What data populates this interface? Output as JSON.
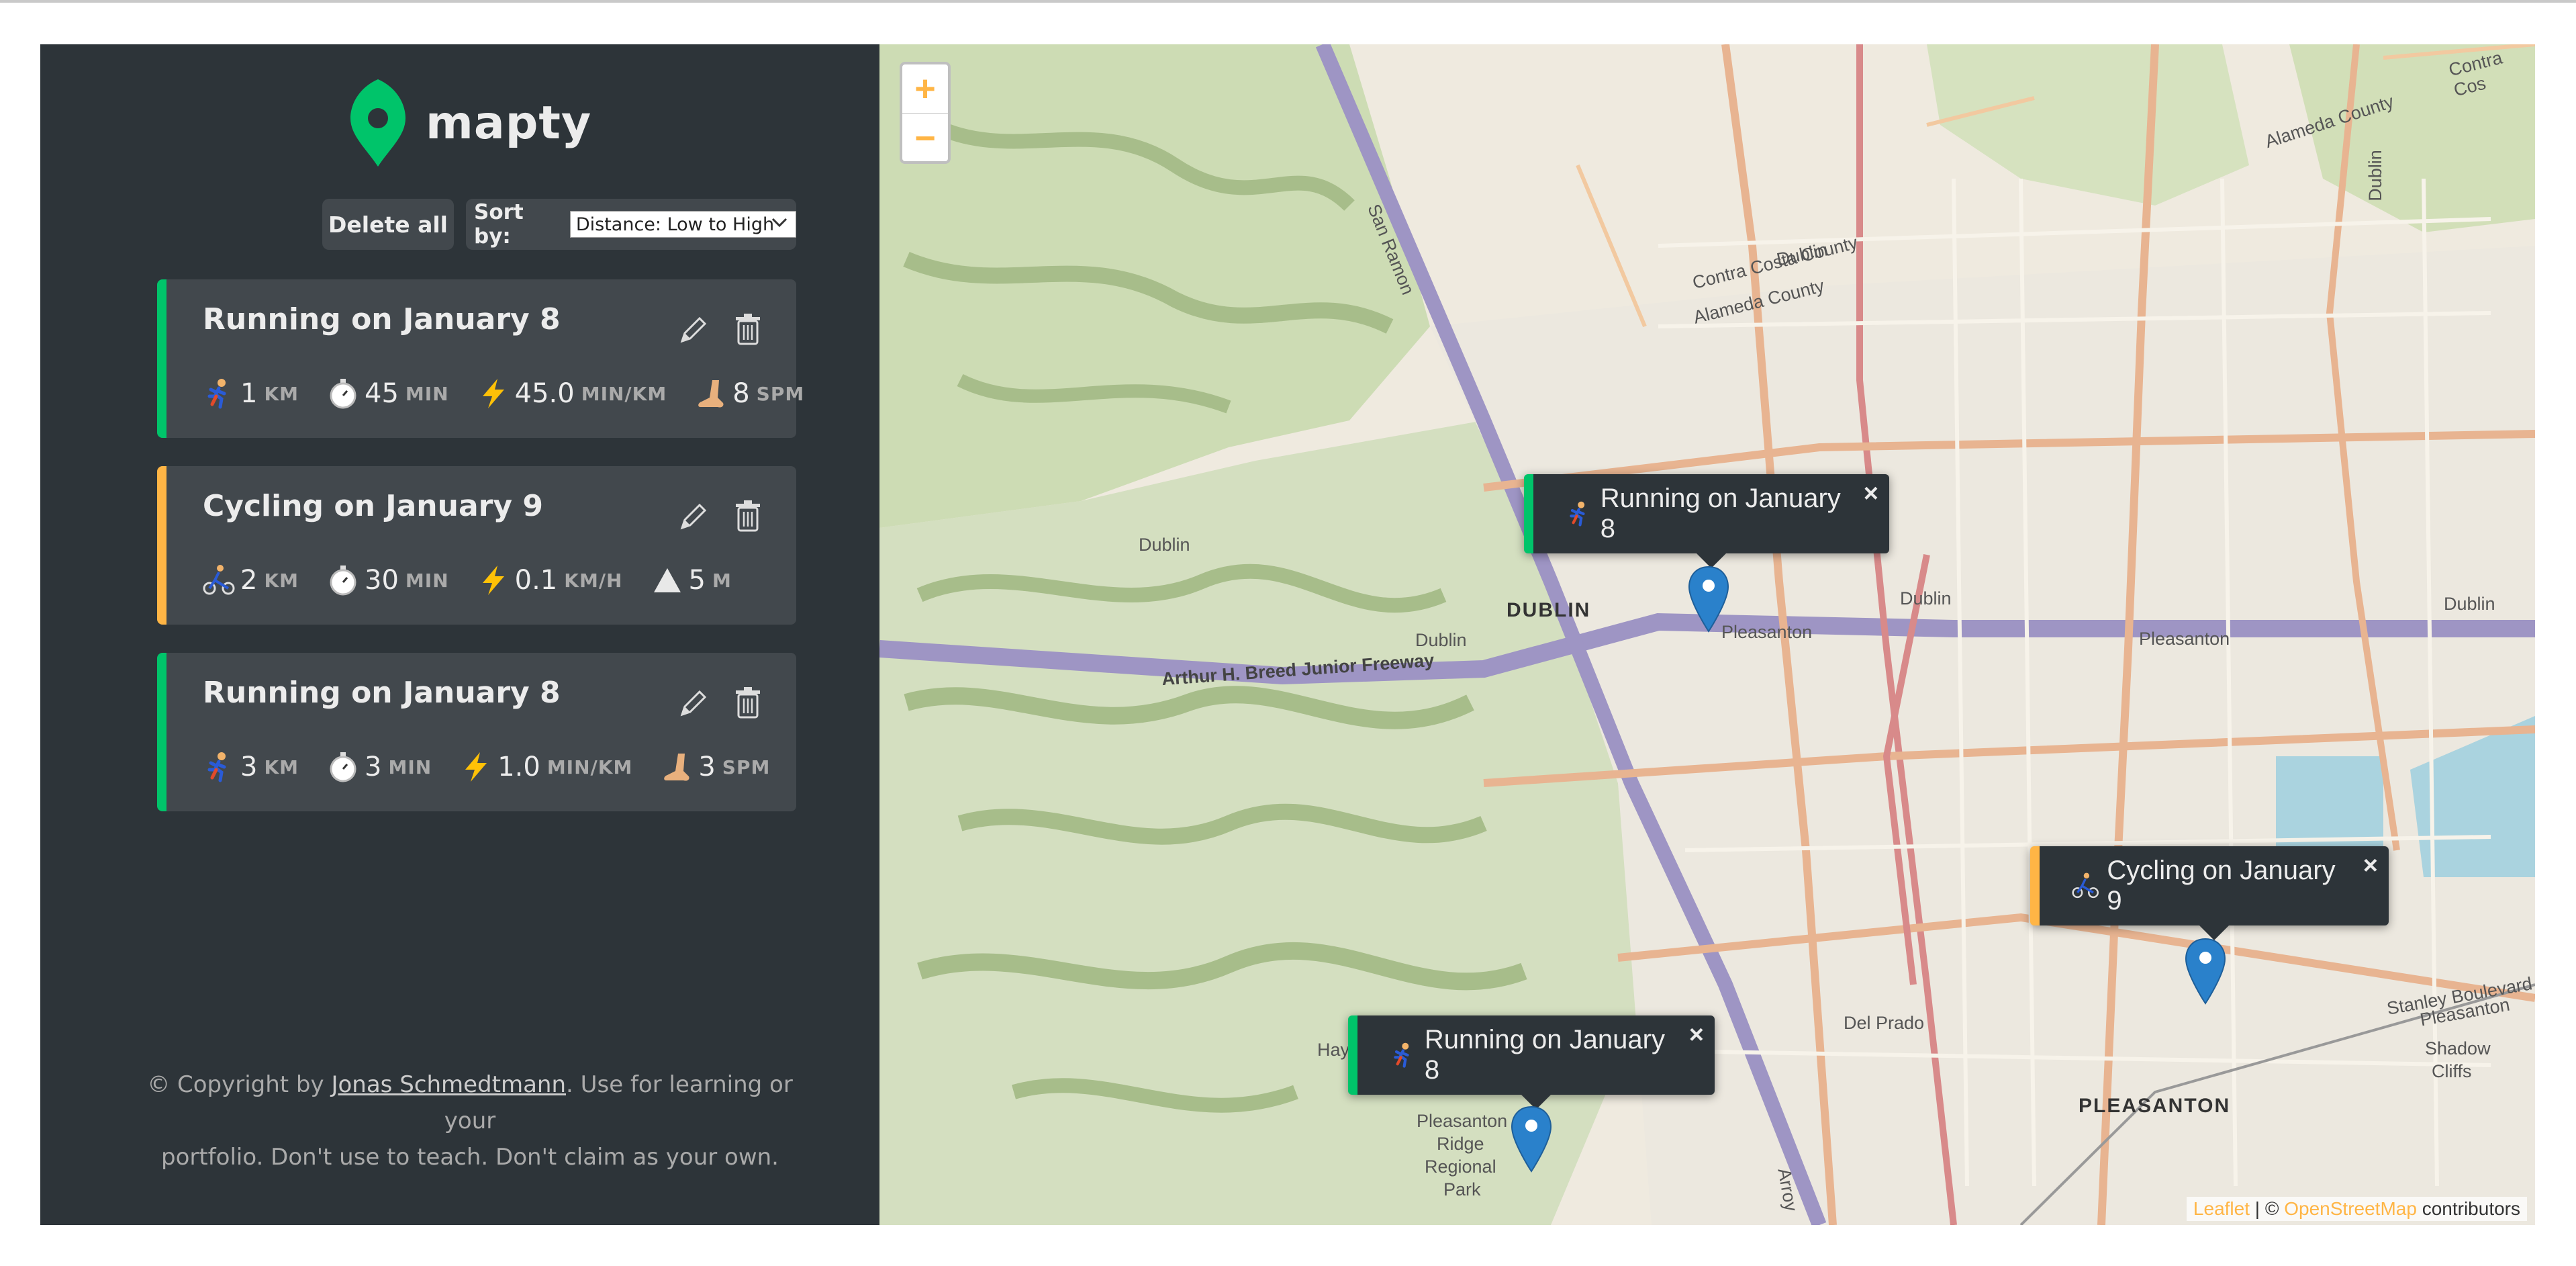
{
  "app": {
    "name": "mapty"
  },
  "controls": {
    "delete_all_label": "Delete all",
    "sort_label": "Sort by:",
    "sort_value": "Distance: Low to High"
  },
  "workouts": [
    {
      "type": "running",
      "title": "Running on January 8",
      "distance": "1",
      "distance_unit": "KM",
      "duration": "45",
      "duration_unit": "MIN",
      "pace": "45.0",
      "pace_unit": "MIN/KM",
      "cadence": "8",
      "cadence_unit": "SPM"
    },
    {
      "type": "cycling",
      "title": "Cycling on January 9",
      "distance": "2",
      "distance_unit": "KM",
      "duration": "30",
      "duration_unit": "MIN",
      "speed": "0.1",
      "speed_unit": "KM/H",
      "elevation": "5",
      "elevation_unit": "M"
    },
    {
      "type": "running",
      "title": "Running on January 8",
      "distance": "3",
      "distance_unit": "KM",
      "duration": "3",
      "duration_unit": "MIN",
      "pace": "1.0",
      "pace_unit": "MIN/KM",
      "cadence": "3",
      "cadence_unit": "SPM"
    }
  ],
  "footer": {
    "copyright_prefix": "© Copyright by ",
    "author": "Jonas Schmedtmann",
    "copyright_suffix": ". Use for learning or your",
    "copyright_line2": "portfolio. Don't use to teach. Don't claim as your own."
  },
  "map": {
    "zoom_in": "+",
    "zoom_out": "−",
    "attribution_leaflet": "Leaflet",
    "attribution_sep": " | © ",
    "attribution_osm": "OpenStreetMap",
    "attribution_suffix": " contributors",
    "popups": [
      {
        "type": "running",
        "label": "Running on January 8",
        "close": "×"
      },
      {
        "type": "cycling",
        "label": "Cycling on January 9",
        "close": "×"
      },
      {
        "type": "running",
        "label": "Running on January 8",
        "close": "×"
      }
    ],
    "labels": {
      "dublin_big": "DUBLIN",
      "pleasanton_big": "PLEASANTON",
      "freeway": "Arthur H. Breed Junior Freeway",
      "contra_costa": "Contra Costa County",
      "alameda": "Alameda County",
      "alameda_ne": "Alameda County",
      "contra_ne": "Contra Cos",
      "dublin_top": "Dublin",
      "dublin_left": "Dublin",
      "dublin_mid": "Dublin",
      "dublin_road": "Dublin",
      "dublin_right": "Dublin",
      "dublin_vert": "Dublin",
      "pleasanton_small": "Pleasanton",
      "pleasanton_road": "Pleasanton",
      "san_ramon": "San Ramon",
      "del_prado": "Del Prado",
      "hay": "Hay",
      "pleasanton_ridge_1": "Pleasanton",
      "pleasanton_ridge_2": "Ridge",
      "pleasanton_ridge_3": "Regional",
      "pleasanton_ridge_4": "Park",
      "stanley": "Stanley Boulevard",
      "pleasanton_se": "Pleasanton",
      "shadow_1": "Shadow",
      "shadow_2": "Cliffs",
      "arroyo": "Arroy"
    }
  },
  "colors": {
    "running": "#00c46a",
    "cycling": "#ffb545",
    "sidebar_bg": "#2d3439",
    "card_bg": "#42484d",
    "marker": "#2a81cb"
  },
  "icons": {
    "logo": "map-pin-logo-icon",
    "edit": "pencil-icon",
    "delete": "trash-icon",
    "runner": "runner-icon",
    "cyclist": "cyclist-icon",
    "stopwatch": "stopwatch-icon",
    "lightning": "lightning-icon",
    "foot": "foot-icon",
    "mountain": "mountain-icon"
  }
}
